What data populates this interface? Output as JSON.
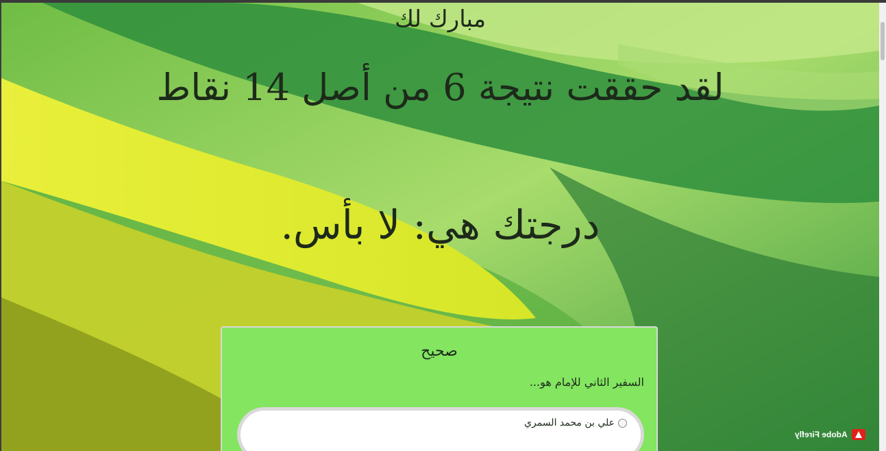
{
  "result": {
    "congrats": "مبارك لك",
    "score_text": "لقد حققت نتيجة 6 من أصل 14 نقاط",
    "grade_text": "درجتك هي: لا بأس."
  },
  "question_card": {
    "status": "صحيح",
    "question": "السفير الثاني للإمام هو...",
    "options": [
      {
        "label": "علي بن محمد السمري",
        "selected": false
      }
    ],
    "background_color": "#83e560"
  },
  "watermark": {
    "text": "Adobe Firefly",
    "icon": "adobe-logo-icon"
  },
  "theme": {
    "background_colors": [
      "#c8ec84",
      "#5aa63c",
      "#2f8a3a",
      "#e9ea2a",
      "#9aa51a"
    ]
  }
}
